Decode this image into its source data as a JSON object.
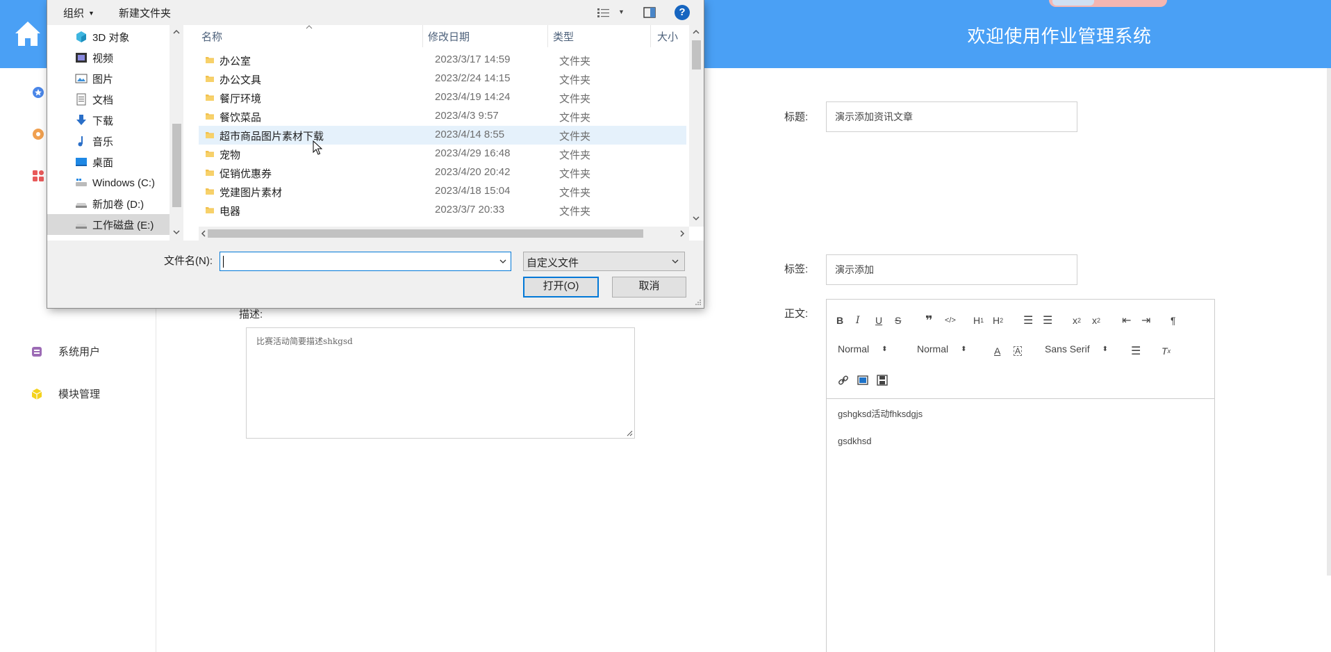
{
  "app": {
    "welcome": "欢迎使用作业管理系统",
    "sidebar": [
      {
        "label": "系统用户",
        "icon": "database-icon"
      },
      {
        "label": "模块管理",
        "icon": "cube-icon"
      }
    ]
  },
  "form": {
    "title_label": "标题:",
    "title_value": "演示添加资讯文章",
    "tag_label": "标签:",
    "tag_value": "演示添加",
    "body_label": "正文:",
    "desc_label": "描述:",
    "desc_value": "比赛活动简要描述shkgsd",
    "editor": {
      "header_select": "Normal",
      "size_select": "Normal",
      "font_select": "Sans Serif",
      "content_line1": "gshgksd活动fhksdgjs",
      "content_line2": "gsdkhsd"
    }
  },
  "dialog": {
    "toolbar": {
      "organize": "组织",
      "new_folder": "新建文件夹"
    },
    "nav": [
      {
        "label": "3D 对象",
        "icon": "cube-3d-icon"
      },
      {
        "label": "视频",
        "icon": "video-icon"
      },
      {
        "label": "图片",
        "icon": "picture-icon"
      },
      {
        "label": "文档",
        "icon": "document-icon"
      },
      {
        "label": "下载",
        "icon": "download-icon"
      },
      {
        "label": "音乐",
        "icon": "music-icon"
      },
      {
        "label": "桌面",
        "icon": "desktop-icon"
      },
      {
        "label": "Windows (C:)",
        "icon": "windows-drive-icon"
      },
      {
        "label": "新加卷 (D:)",
        "icon": "drive-icon"
      },
      {
        "label": "工作磁盘 (E:)",
        "icon": "drive-icon",
        "selected": true
      }
    ],
    "columns": {
      "name": "名称",
      "date": "修改日期",
      "type": "类型",
      "size": "大小"
    },
    "files": [
      {
        "name": "办公室",
        "date": "2023/3/17 14:59",
        "type": "文件夹"
      },
      {
        "name": "办公文具",
        "date": "2023/2/24 14:15",
        "type": "文件夹"
      },
      {
        "name": "餐厅环境",
        "date": "2023/4/19 14:24",
        "type": "文件夹"
      },
      {
        "name": "餐饮菜品",
        "date": "2023/4/3 9:57",
        "type": "文件夹"
      },
      {
        "name": "超市商品图片素材下载",
        "date": "2023/4/14 8:55",
        "type": "文件夹",
        "hover": true
      },
      {
        "name": "宠物",
        "date": "2023/4/29 16:48",
        "type": "文件夹"
      },
      {
        "name": "促销优惠券",
        "date": "2023/4/20 20:42",
        "type": "文件夹"
      },
      {
        "name": "党建图片素材",
        "date": "2023/4/18 15:04",
        "type": "文件夹"
      },
      {
        "name": "电器",
        "date": "2023/3/7 20:33",
        "type": "文件夹"
      }
    ],
    "filename_label": "文件名(N):",
    "filename_value": "",
    "filter": "自定义文件",
    "open_button": "打开(O)",
    "cancel_button": "取消"
  },
  "colors": {
    "topbar": "#4aa0f5",
    "folder": "#f2c14e",
    "accent": "#0078d7"
  }
}
